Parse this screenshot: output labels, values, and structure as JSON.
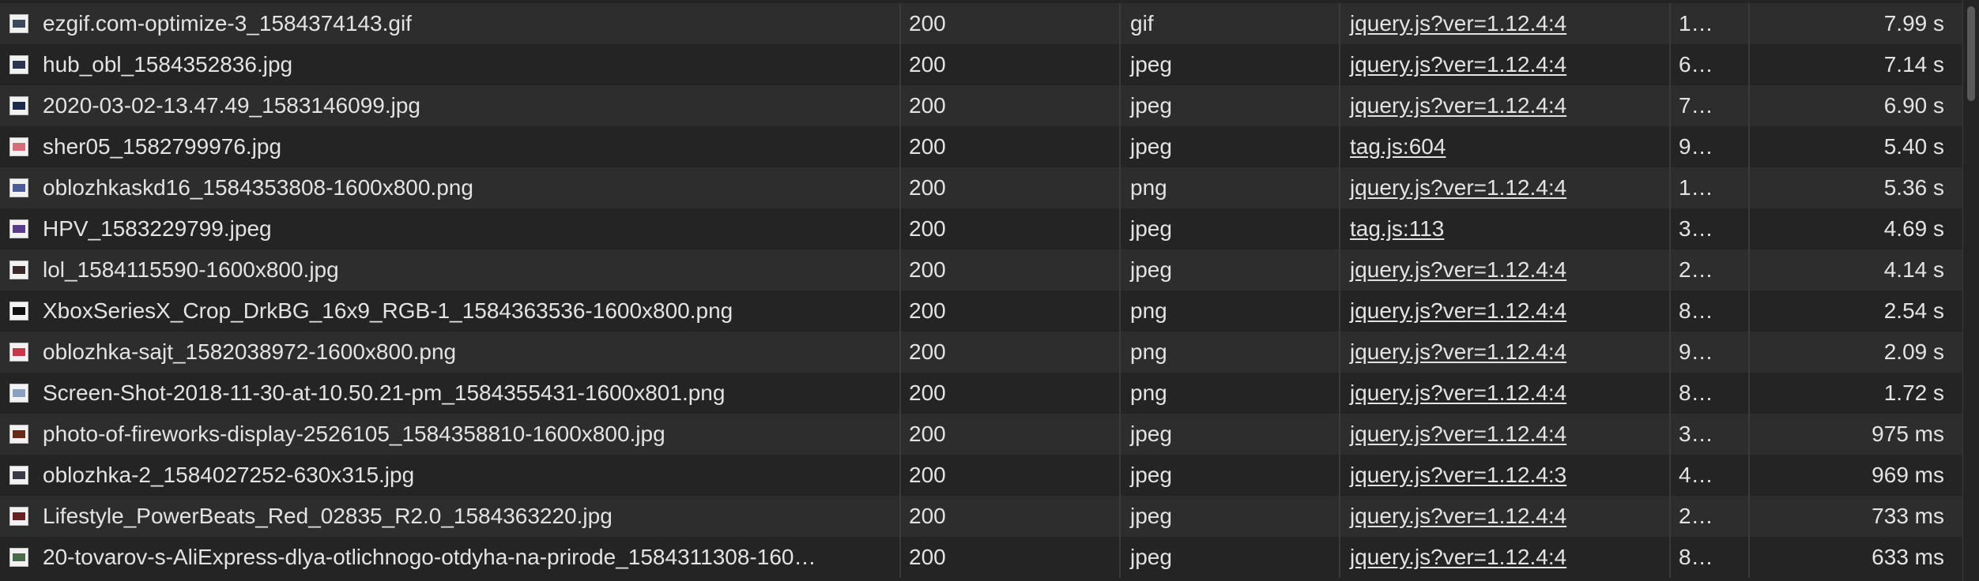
{
  "rows": [
    {
      "name": "ezgif.com-optimize-3_1584374143.gif",
      "status": "200",
      "type": "gif",
      "initiator": "jquery.js?ver=1.12.4:4",
      "size": "1…",
      "time": "7.99 s",
      "thumb_color": "#3b4a5a"
    },
    {
      "name": "hub_obl_1584352836.jpg",
      "status": "200",
      "type": "jpeg",
      "initiator": "jquery.js?ver=1.12.4:4",
      "size": "6…",
      "time": "7.14 s",
      "thumb_color": "#2a3550"
    },
    {
      "name": "2020-03-02-13.47.49_1583146099.jpg",
      "status": "200",
      "type": "jpeg",
      "initiator": "jquery.js?ver=1.12.4:4",
      "size": "7…",
      "time": "6.90 s",
      "thumb_color": "#1c2a4a"
    },
    {
      "name": "sher05_1582799976.jpg",
      "status": "200",
      "type": "jpeg",
      "initiator": "tag.js:604",
      "size": "9…",
      "time": "5.40 s",
      "thumb_color": "#d86a7a"
    },
    {
      "name": "oblozhkaskd16_1584353808-1600x800.png",
      "status": "200",
      "type": "png",
      "initiator": "jquery.js?ver=1.12.4:4",
      "size": "1…",
      "time": "5.36 s",
      "thumb_color": "#4a5a9a"
    },
    {
      "name": "HPV_1583229799.jpeg",
      "status": "200",
      "type": "jpeg",
      "initiator": "tag.js:113",
      "size": "3…",
      "time": "4.69 s",
      "thumb_color": "#5a3a8a"
    },
    {
      "name": "lol_1584115590-1600x800.jpg",
      "status": "200",
      "type": "jpeg",
      "initiator": "jquery.js?ver=1.12.4:4",
      "size": "2…",
      "time": "4.14 s",
      "thumb_color": "#3a2a2a"
    },
    {
      "name": "XboxSeriesX_Crop_DrkBG_16x9_RGB-1_1584363536-1600x800.png",
      "status": "200",
      "type": "png",
      "initiator": "jquery.js?ver=1.12.4:4",
      "size": "8…",
      "time": "2.54 s",
      "thumb_color": "#111111"
    },
    {
      "name": "oblozhka-sajt_1582038972-1600x800.png",
      "status": "200",
      "type": "png",
      "initiator": "jquery.js?ver=1.12.4:4",
      "size": "9…",
      "time": "2.09 s",
      "thumb_color": "#c03a4a"
    },
    {
      "name": "Screen-Shot-2018-11-30-at-10.50.21-pm_1584355431-1600x801.png",
      "status": "200",
      "type": "png",
      "initiator": "jquery.js?ver=1.12.4:4",
      "size": "8…",
      "time": "1.72 s",
      "thumb_color": "#8aa0c0"
    },
    {
      "name": "photo-of-fireworks-display-2526105_1584358810-1600x800.jpg",
      "status": "200",
      "type": "jpeg",
      "initiator": "jquery.js?ver=1.12.4:4",
      "size": "3…",
      "time": "975 ms",
      "thumb_color": "#6a2a1a"
    },
    {
      "name": "oblozhka-2_1584027252-630x315.jpg",
      "status": "200",
      "type": "jpeg",
      "initiator": "jquery.js?ver=1.12.4:3",
      "size": "4…",
      "time": "969 ms",
      "thumb_color": "#3a3a4a"
    },
    {
      "name": "Lifestyle_PowerBeats_Red_02835_R2.0_1584363220.jpg",
      "status": "200",
      "type": "jpeg",
      "initiator": "jquery.js?ver=1.12.4:4",
      "size": "2…",
      "time": "733 ms",
      "thumb_color": "#6a2020"
    },
    {
      "name": "20-tovarov-s-AliExpress-dlya-otlichnogo-otdyha-na-prirode_1584311308-160…",
      "status": "200",
      "type": "jpeg",
      "initiator": "jquery.js?ver=1.12.4:4",
      "size": "8…",
      "time": "633 ms",
      "thumb_color": "#4a6a4a"
    }
  ]
}
